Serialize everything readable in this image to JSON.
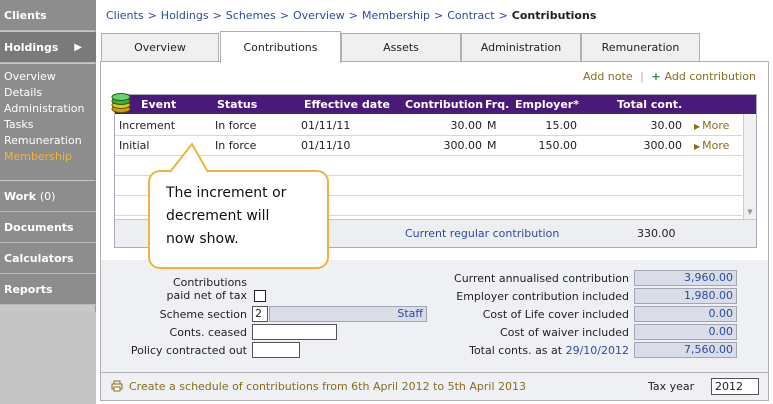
{
  "sidebar": {
    "clients": "Clients",
    "holdings": "Holdings",
    "holdings_arrow": "▶",
    "sub_items": [
      "Overview",
      "Details",
      "Administration",
      "Tasks",
      "Remuneration",
      "Membership"
    ],
    "work": "Work",
    "work_count": "(0)",
    "documents": "Documents",
    "calculators": "Calculators",
    "reports": "Reports"
  },
  "breadcrumb": [
    "Clients",
    "Holdings",
    "Schemes",
    "Overview",
    "Membership",
    "Contract"
  ],
  "breadcrumb_sep": ">",
  "breadcrumb_current": "Contributions",
  "tabs": [
    "Overview",
    "Contributions",
    "Assets",
    "Administration",
    "Remuneration"
  ],
  "actions": {
    "add_note": "Add note",
    "add_contribution": "Add contribution"
  },
  "grid": {
    "headers": [
      "Event",
      "Status",
      "Effective date",
      "Contribution",
      "Frq.",
      "Employer*",
      "Total cont."
    ],
    "rows": [
      {
        "event": "Increment",
        "status": "In force",
        "date": "01/11/11",
        "contribution": "30.00",
        "frq": "M",
        "employer": "15.00",
        "total": "30.00",
        "more": "More"
      },
      {
        "event": "Initial",
        "status": "In force",
        "date": "01/11/10",
        "contribution": "300.00",
        "frq": "M",
        "employer": "150.00",
        "total": "300.00",
        "more": "More"
      }
    ],
    "footer_label": "Current regular contribution",
    "footer_value": "330.00"
  },
  "callout": {
    "line1": "The increment or",
    "line2": "decrement will",
    "line3": "now show."
  },
  "form": {
    "paid_net_l1": "Contributions",
    "paid_net_l2": "paid net of tax",
    "scheme_section_label": "Scheme section",
    "scheme_section_value": "2",
    "scheme_section_name": "Staff",
    "conts_ceased_label": "Conts. ceased",
    "policy_contracted_label": "Policy contracted out",
    "annualised_label": "Current annualised contribution",
    "annualised_value": "3,960.00",
    "employer_included_label": "Employer contribution included",
    "employer_included_value": "1,980.00",
    "life_cover_label": "Cost of Life cover included",
    "life_cover_value": "0.00",
    "waiver_label": "Cost of waiver included",
    "waiver_value": "0.00",
    "total_conts_label": "Total conts. as at",
    "total_conts_date": "29/10/2012",
    "total_conts_value": "7,560.00"
  },
  "footer": {
    "schedule_link": "Create a schedule of contributions from 6th April 2012 to 5th April 2013",
    "tax_year_label": "Tax year",
    "tax_year_value": "2012"
  },
  "colors": {
    "grid_header": "#4a1a7a",
    "link_blue": "#2b4c9b",
    "action_gold": "#8a6d1a",
    "callout_border": "#f0b43c",
    "sidebar_active": "#f0b43c"
  }
}
